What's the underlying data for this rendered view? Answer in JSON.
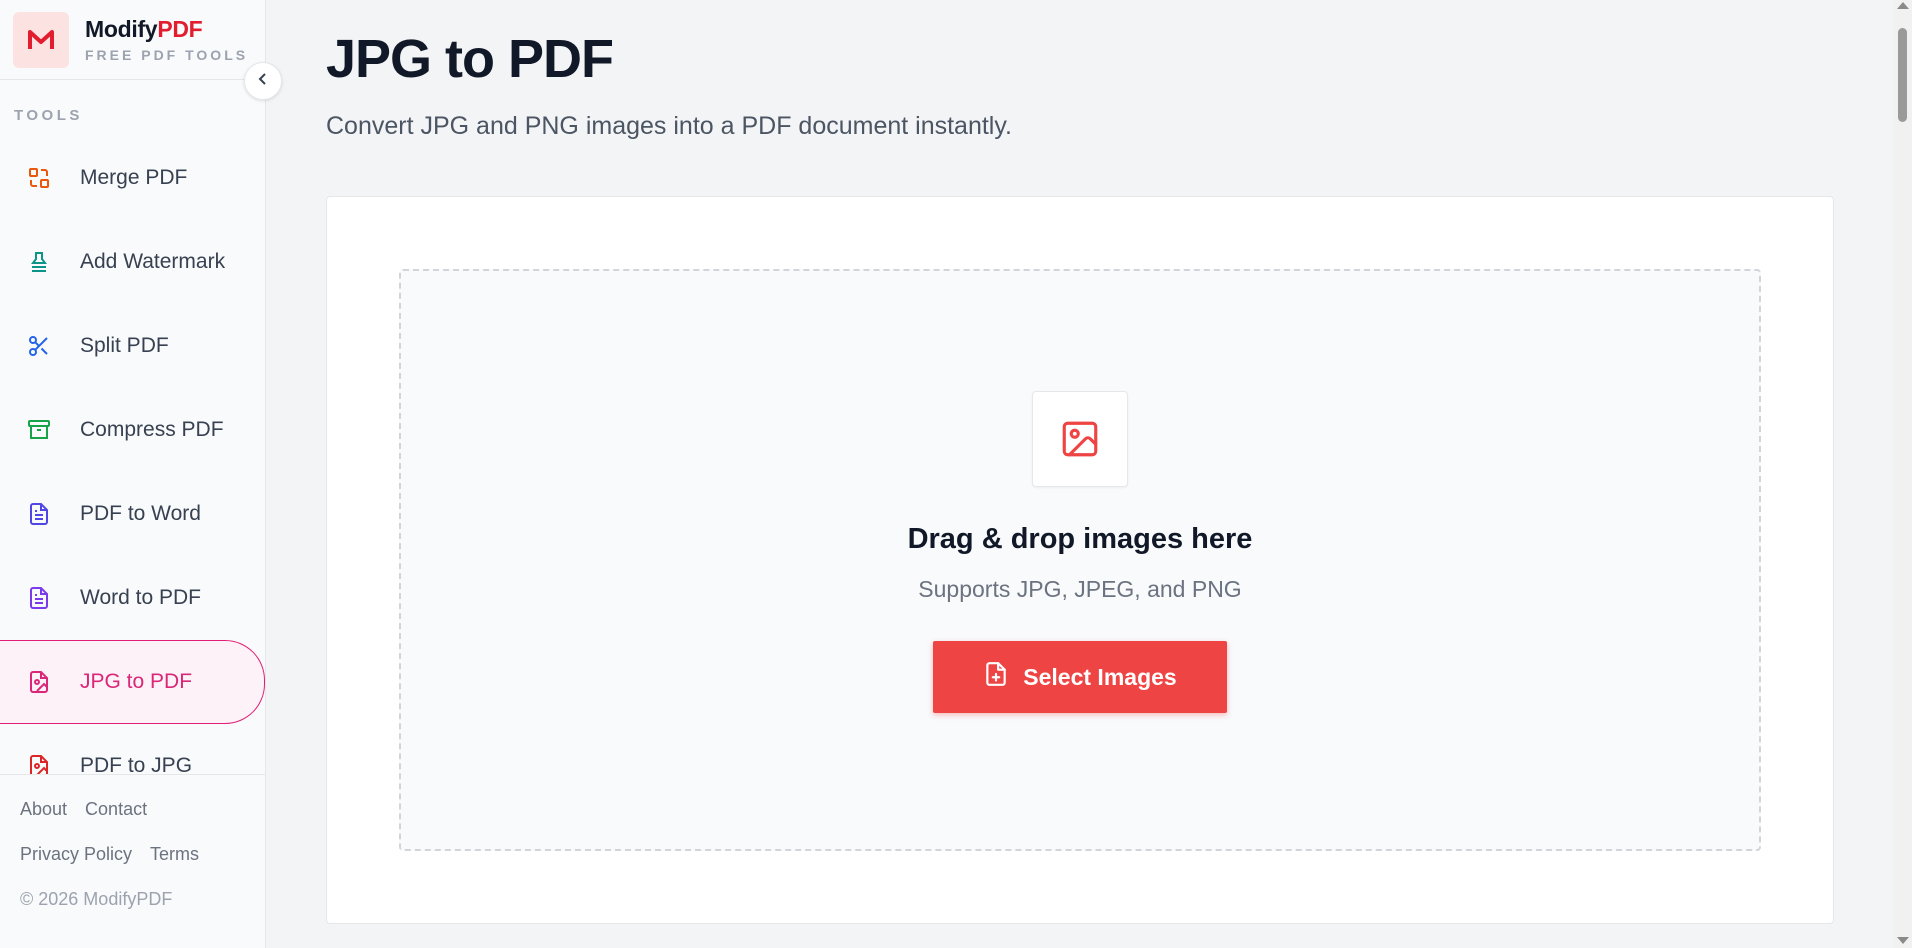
{
  "brand": {
    "name_main": "Modify",
    "name_accent": "PDF",
    "tagline": "FREE PDF TOOLS",
    "logo_icon": "modifypdf-logo-icon"
  },
  "sidebar": {
    "section_label": "TOOLS",
    "collapse_icon": "chevron-left-icon",
    "items": [
      {
        "label": "Merge PDF",
        "icon": "merge-icon",
        "color": "#ea580c",
        "active": false
      },
      {
        "label": "Add Watermark",
        "icon": "stamp-icon",
        "color": "#0d9488",
        "active": false
      },
      {
        "label": "Split PDF",
        "icon": "scissors-icon",
        "color": "#2563eb",
        "active": false
      },
      {
        "label": "Compress PDF",
        "icon": "archive-icon",
        "color": "#16a34a",
        "active": false
      },
      {
        "label": "PDF to Word",
        "icon": "document-icon",
        "color": "#4f46e5",
        "active": false
      },
      {
        "label": "Word to PDF",
        "icon": "document-icon",
        "color": "#7c3aed",
        "active": false
      },
      {
        "label": "JPG to PDF",
        "icon": "image-file-icon",
        "color": "#db2777",
        "active": true
      },
      {
        "label": "PDF to JPG",
        "icon": "image-file-icon",
        "color": "#dc2626",
        "active": false
      }
    ],
    "footer": {
      "about": "About",
      "contact": "Contact",
      "privacy": "Privacy Policy",
      "terms": "Terms",
      "copyright": "© 2026 ModifyPDF"
    }
  },
  "main": {
    "title": "JPG to PDF",
    "subtitle": "Convert JPG and PNG images into a PDF document instantly.",
    "dropzone": {
      "icon": "image-icon",
      "title": "Drag & drop images here",
      "subtitle": "Supports JPG, JPEG, and PNG",
      "button_label": "Select Images",
      "button_icon": "file-plus-icon"
    }
  },
  "colors": {
    "accent": "#ef4444",
    "active": "#db2777",
    "brand_accent": "#e11d2e"
  }
}
